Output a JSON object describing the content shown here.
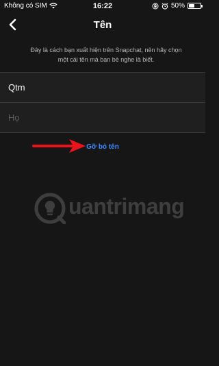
{
  "status_bar": {
    "carrier": "Không có SIM",
    "time": "16:22",
    "battery": "50%",
    "battery_level": 0.5
  },
  "header": {
    "title": "Tên",
    "back_icon": "chevron-left-icon"
  },
  "description": "Đây là cách bạn xuất hiện trên Snapchat, nên hãy chọn một cái tên mà bạn bè nghe là biết.",
  "form": {
    "first_name_value": "Qtm",
    "last_name_value": "",
    "last_name_placeholder": "Họ"
  },
  "remove_name_label": "Gỡ bỏ tên",
  "watermark": "uantrimang",
  "colors": {
    "background": "#161616",
    "field_background": "#1f1f1f",
    "link": "#3d8bff",
    "arrow": "#e8141b"
  }
}
